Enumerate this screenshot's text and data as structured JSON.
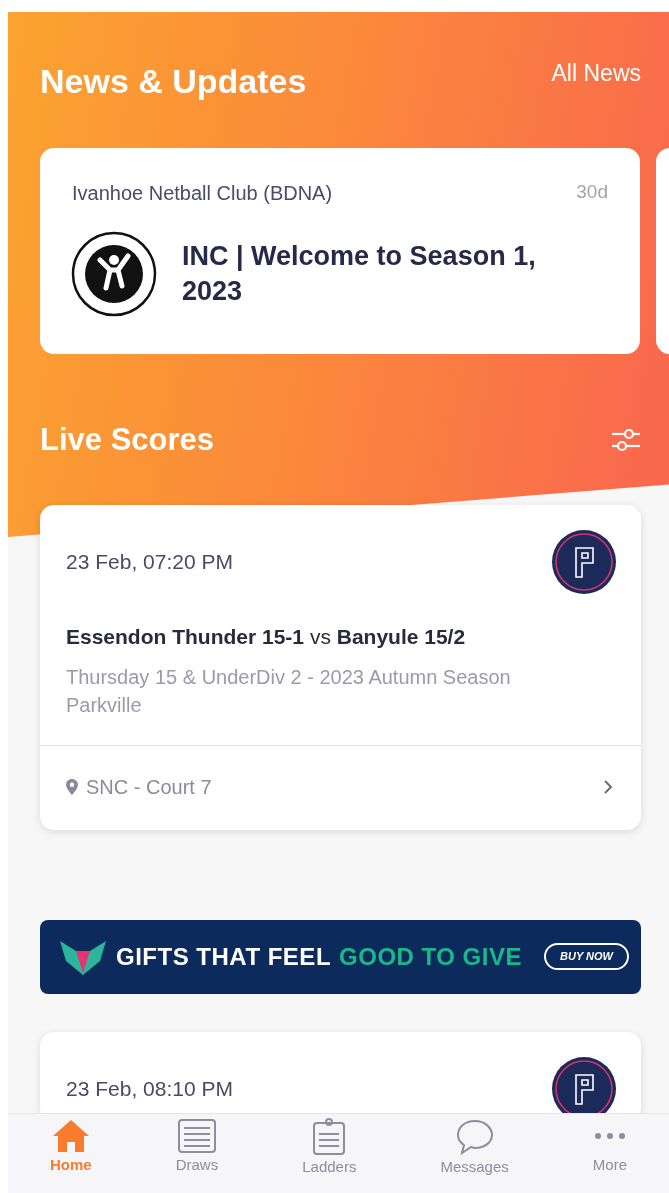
{
  "header": {
    "title": "News & Updates",
    "link": "All News"
  },
  "news": [
    {
      "source": "Ivanhoe Netball Club (BDNA)",
      "age": "30d",
      "headline": "INC | Welcome to Season 1, 2023"
    }
  ],
  "live_scores": {
    "title": "Live Scores"
  },
  "matches": [
    {
      "datetime": "23 Feb, 07:20 PM",
      "teams": "**Essendon Thunder 15-1** vs **Banyule 15/2**",
      "competition": "Thursday 15 & UnderDiv 2 - 2023 Autumn Season Parkville",
      "venue": "SNC - Court 7"
    },
    {
      "datetime": "23 Feb, 08:10 PM"
    }
  ],
  "ad_banner": {
    "text_1": "GIFTS THAT FEEL",
    "text_2": "GOOD TO GIVE",
    "button": "BUY NOW"
  },
  "tabs": [
    {
      "label": "Home",
      "kind": "home",
      "selected": true
    },
    {
      "label": "Draws",
      "kind": "draws",
      "selected": false
    },
    {
      "label": "Ladders",
      "kind": "ladders",
      "selected": false
    },
    {
      "label": "Messages",
      "kind": "messages",
      "selected": false
    },
    {
      "label": "More",
      "kind": "more",
      "selected": false
    }
  ]
}
